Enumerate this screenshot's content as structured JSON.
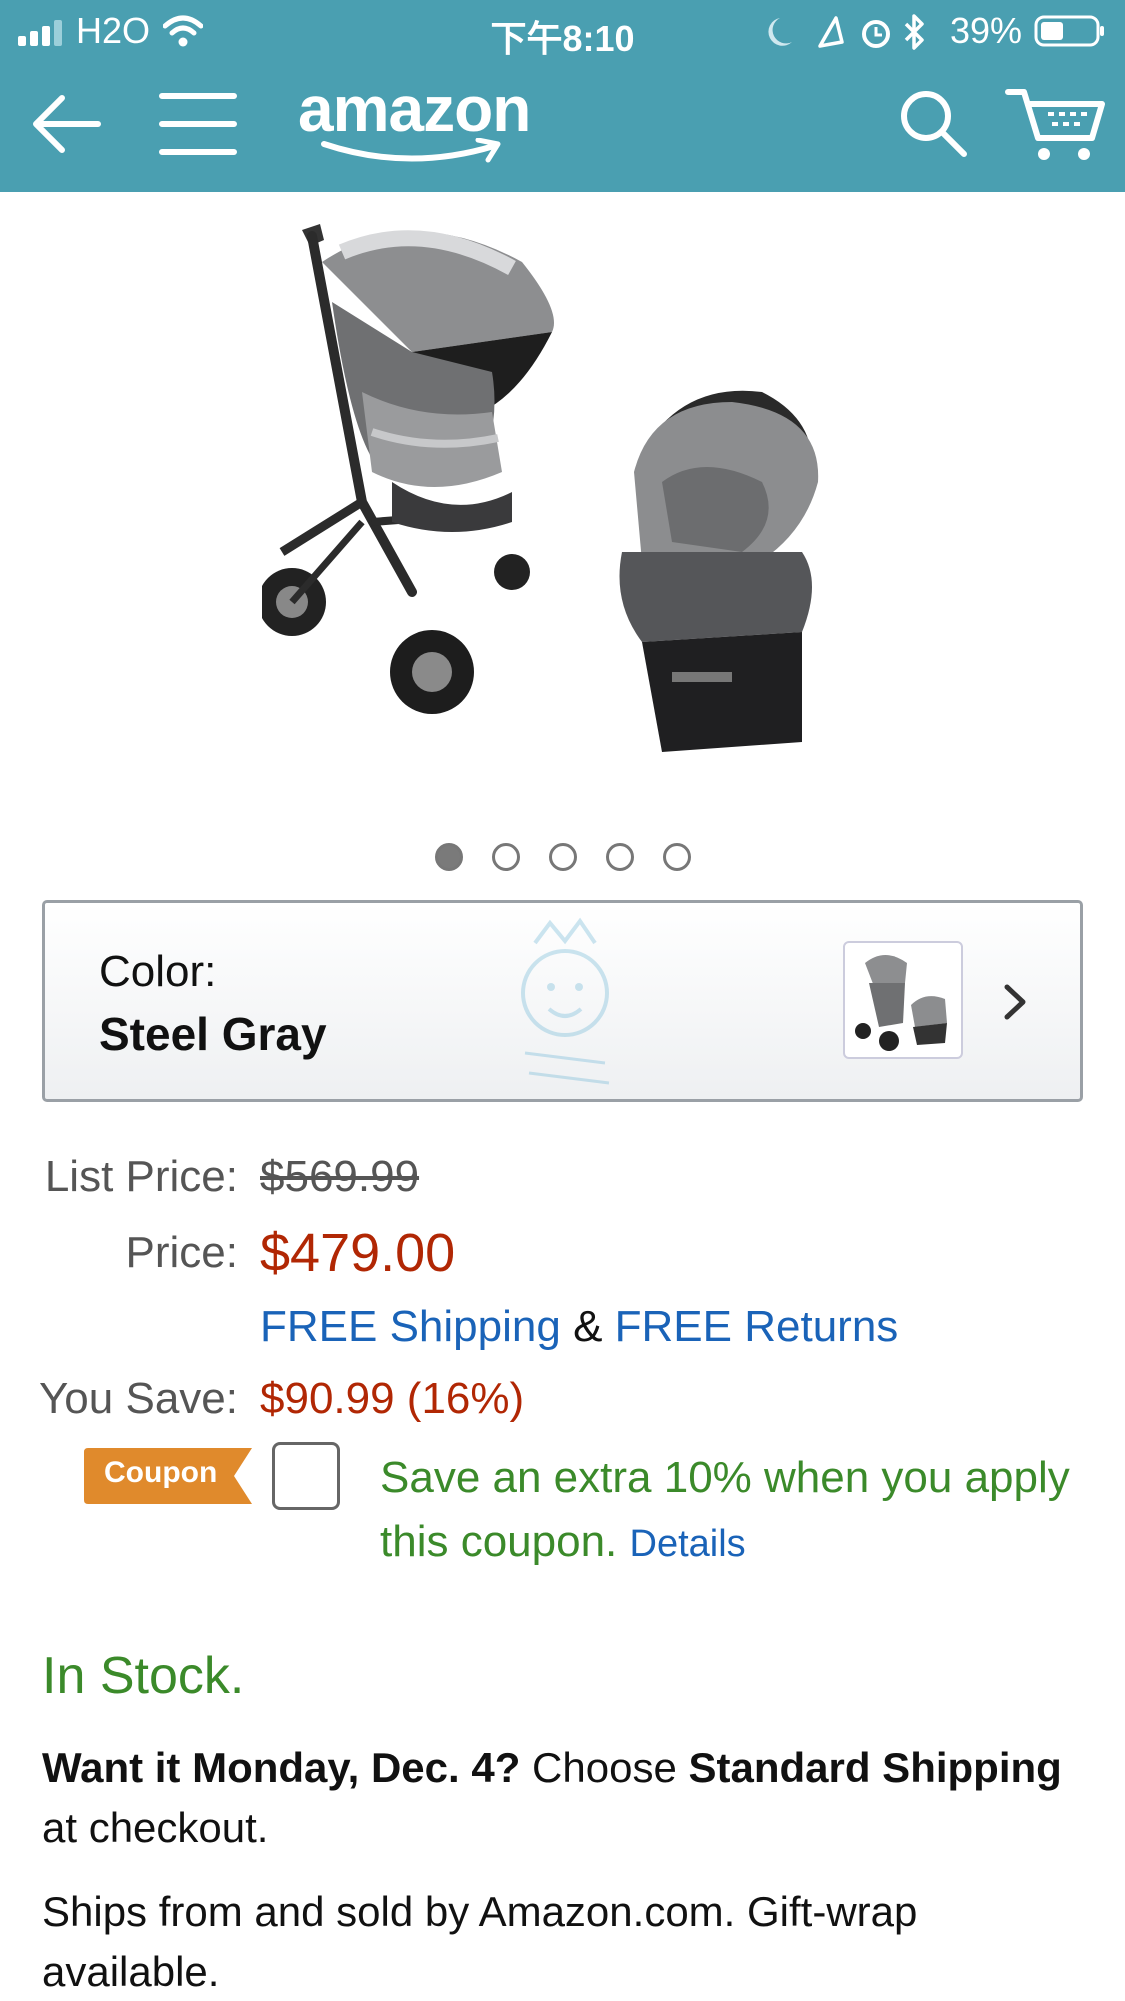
{
  "status_bar": {
    "carrier": "H2O",
    "time": "下午8:10",
    "battery": "39%"
  },
  "header": {
    "logo": "amazon",
    "icons": [
      "back-arrow-icon",
      "menu-icon",
      "search-icon",
      "cart-icon"
    ],
    "brand_color": "#4a9fb1"
  },
  "gallery": {
    "image_alt": "stroller-and-car-seat",
    "dot_count": 5,
    "active_dot": 1
  },
  "variant": {
    "label": "Color:",
    "value": "Steel Gray"
  },
  "pricing": {
    "list_label": "List Price:",
    "list_price": "$569.99",
    "price_label": "Price:",
    "price": "$479.00",
    "shipping_link": "FREE Shipping",
    "ampersand": "&",
    "returns_link": "FREE Returns",
    "save_label": "You Save:",
    "savings": "$90.99 (16%)",
    "price_color": "#b12704"
  },
  "coupon": {
    "tag": "Coupon",
    "message": "Save an extra 10% when you apply this coupon.",
    "details_link": "Details",
    "tag_color": "#e08a2c"
  },
  "availability": {
    "stock": "In Stock.",
    "delivery_prefix": "Want it Monday, Dec. 4?",
    "delivery_mid": "Choose",
    "delivery_bold": "Standard Shipping",
    "delivery_suffix": "at checkout.",
    "seller": "Ships from and sold by Amazon.com. Gift-wrap available."
  }
}
